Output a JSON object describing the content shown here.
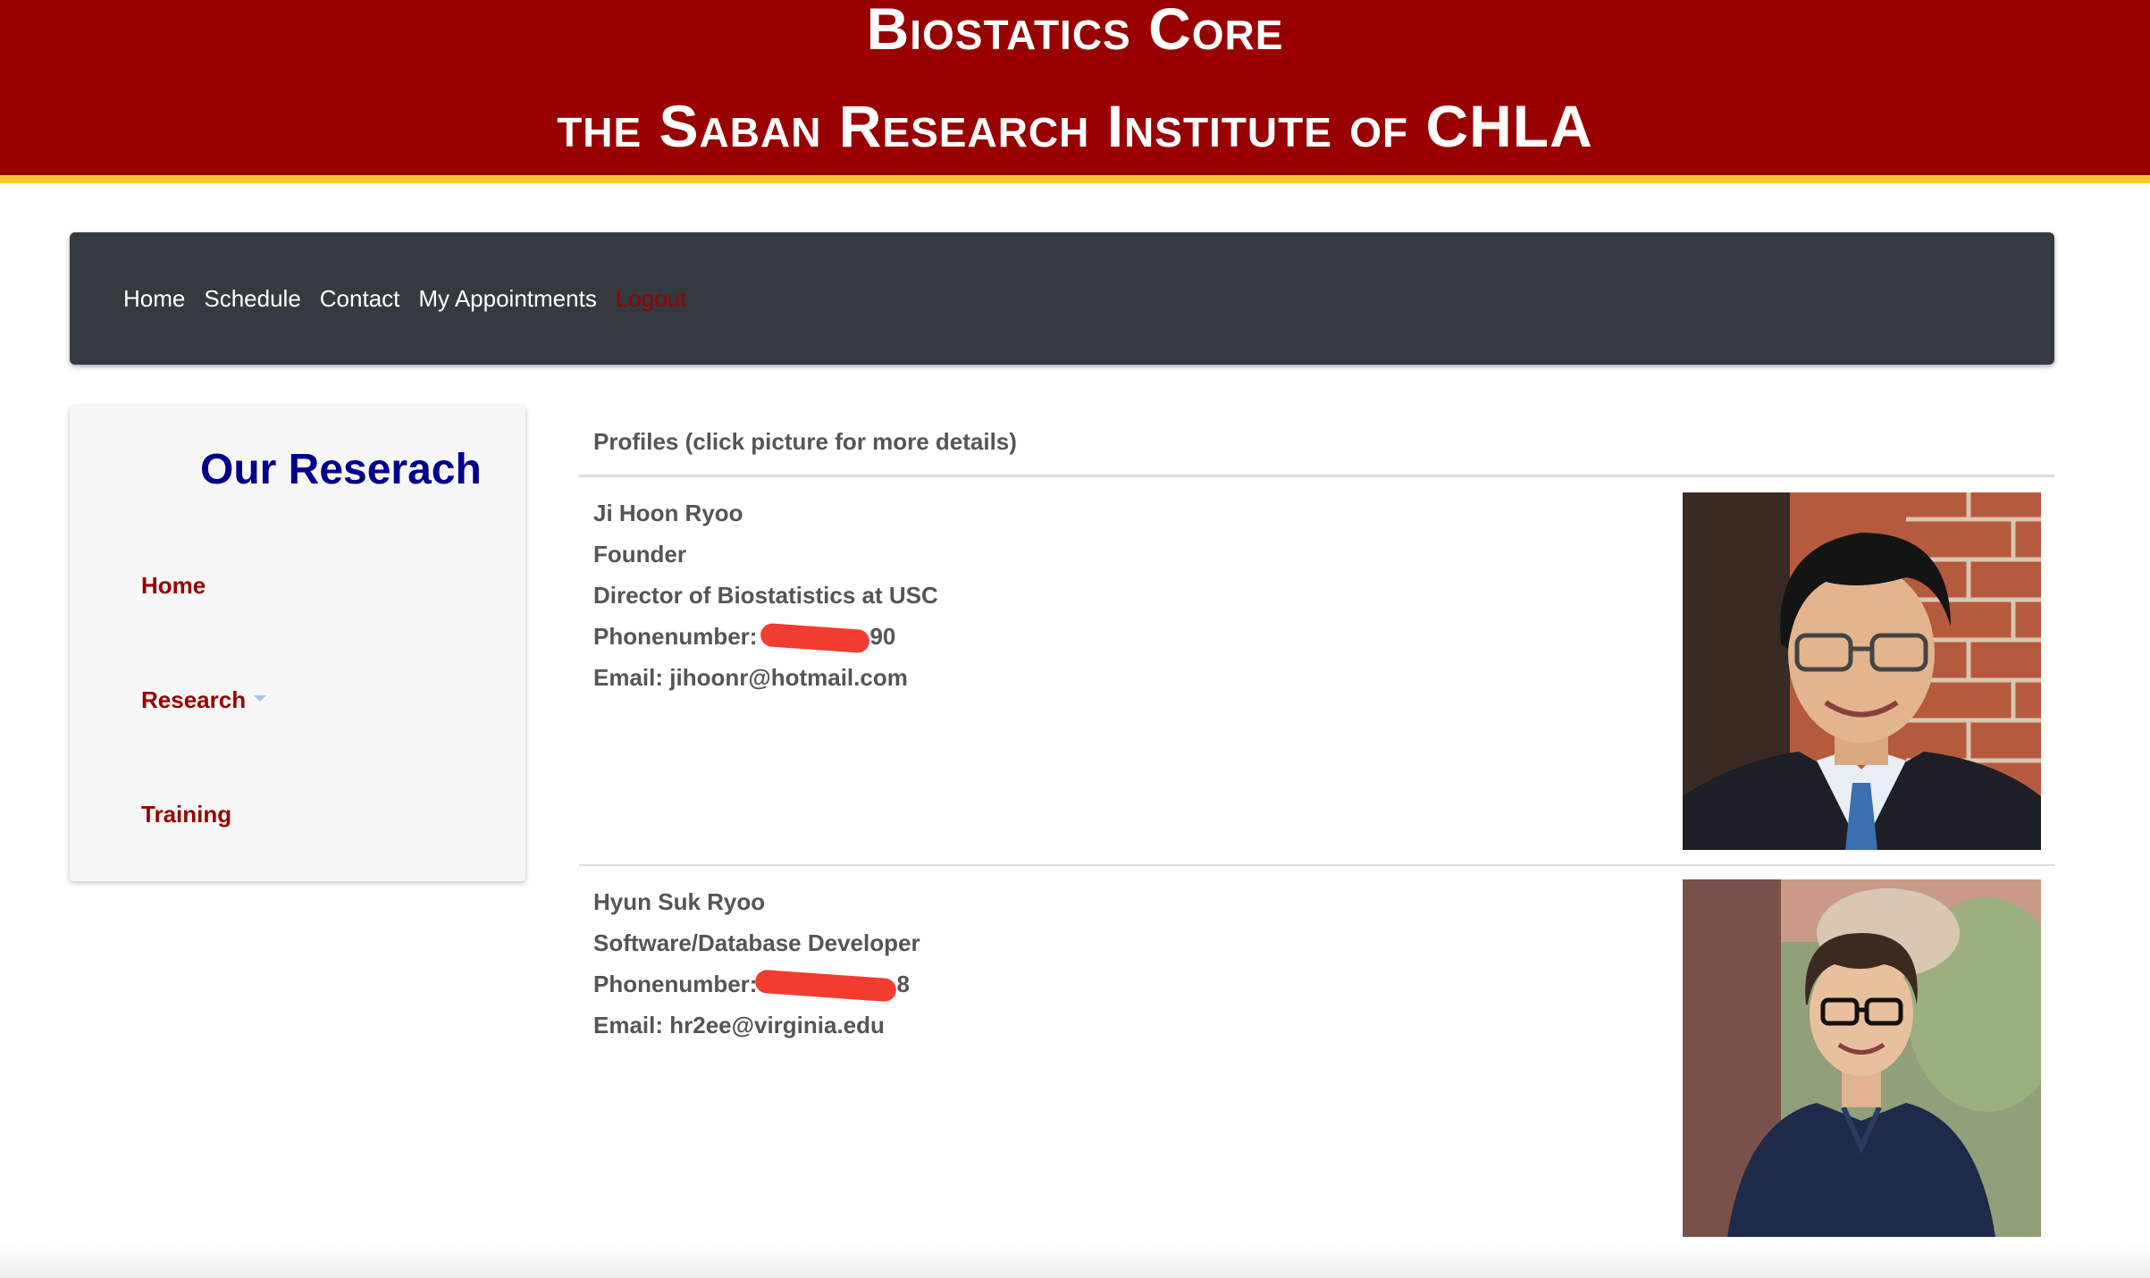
{
  "banner": {
    "line1": "Biostatics Core",
    "line2": "the Saban Research Institute of CHLA",
    "colors": {
      "background": "#990000",
      "stripe": "#ffc72c",
      "text": "#ffffff"
    }
  },
  "navbar": {
    "items": [
      "Home",
      "Schedule",
      "Contact",
      "My Appointments"
    ],
    "logout": "Logout",
    "colors": {
      "background": "#343a40",
      "link": "#ffffff",
      "logout": "#990000"
    }
  },
  "sidebar": {
    "title": "Our Reserach",
    "items": [
      {
        "label": "Home"
      },
      {
        "label": "Research",
        "icon": "caret-down-icon"
      },
      {
        "label": "Training"
      }
    ],
    "colors": {
      "title": "#00008b",
      "item": "#990000"
    }
  },
  "profiles": {
    "heading": "Profiles (click picture for more details)",
    "people": [
      {
        "name": "Ji Hoon Ryoo",
        "role": "Founder",
        "position": "Director of Biostatistics at USC",
        "phone_label": "Phonenumber:",
        "phone_visible_suffix": "90",
        "email": "Email: jihoonr@hotmail.com",
        "photo": "profile-photo-ji-hoon-ryoo"
      },
      {
        "name": "Hyun Suk Ryoo",
        "role": "Software/Database Developer",
        "phone_label": "Phonenumber:",
        "phone_visible_suffix": "8",
        "email": "Email: hr2ee@virginia.edu",
        "photo": "profile-photo-hyun-suk-ryoo"
      }
    ]
  }
}
